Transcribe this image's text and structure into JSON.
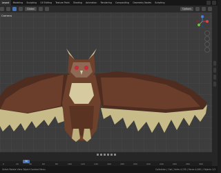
{
  "topbar": {
    "workspaces": [
      "Layout",
      "Modeling",
      "Sculpting",
      "UV Editing",
      "Texture Paint",
      "Shading",
      "Animation",
      "Rendering",
      "Compositing",
      "Geometry Nodes",
      "Scripting"
    ],
    "active_index": 0
  },
  "viewport": {
    "header": {
      "mode_label": "Global",
      "options_label": "Options"
    },
    "camera_label": "Camera",
    "gizmo": {
      "x": "X",
      "y": "Y",
      "z": "Z"
    }
  },
  "timeline": {
    "current_frame": "30",
    "ticks": [
      "0",
      "20",
      "40",
      "60",
      "80",
      "100",
      "120",
      "140",
      "160",
      "180",
      "200",
      "220",
      "240",
      "260",
      "280",
      "300"
    ]
  },
  "statusbar": {
    "left": "Select   Rotate View   Object Context Menu",
    "right": "Collection | Owl  |  Verts 4,135 | Faces 4,060  |  Objects 1/3"
  },
  "colors": {
    "feather_dark": "#5c3626",
    "feather_cream": "#c9bd8b",
    "eye": "#c0303a",
    "accent": "#4772b3"
  }
}
